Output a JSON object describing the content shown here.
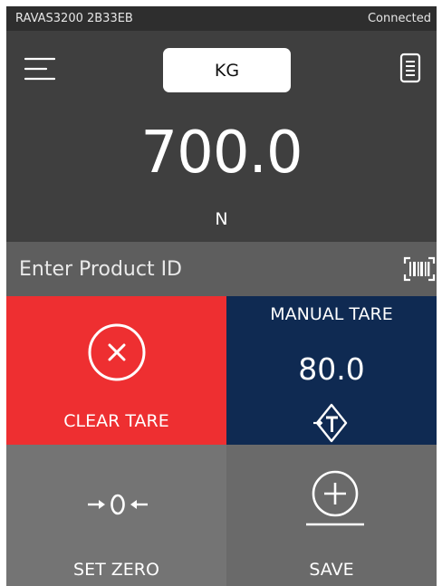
{
  "status_bar": {
    "device_name": "RAVAS3200 2B33EB",
    "connection": "Connected"
  },
  "header": {
    "unit_button": "KG",
    "weight_value": "700.0",
    "weight_unit": "N",
    "icons": [
      "menu-icon",
      "log-icon"
    ]
  },
  "product": {
    "placeholder": "Enter Product ID",
    "icon": "barcode-scanner-icon"
  },
  "tiles": {
    "clear_tare": {
      "label": "CLEAR TARE",
      "icon": "close-circle-icon"
    },
    "manual_tare": {
      "label": "MANUAL TARE",
      "value": "80.0",
      "icon": "tare-icon"
    },
    "set_zero": {
      "label": "SET ZERO",
      "icon": "zero-icon"
    },
    "save": {
      "label": "SAVE",
      "icon": "add-circle-icon"
    }
  },
  "colors": {
    "status_bar": "#2e2e2e",
    "header": "#3f3f3f",
    "product_row": "#5e5e5e",
    "clear_tare": "#ee2f31",
    "manual_tare": "#0f2a52",
    "set_zero": "#747474",
    "save": "#6a6a6a"
  }
}
